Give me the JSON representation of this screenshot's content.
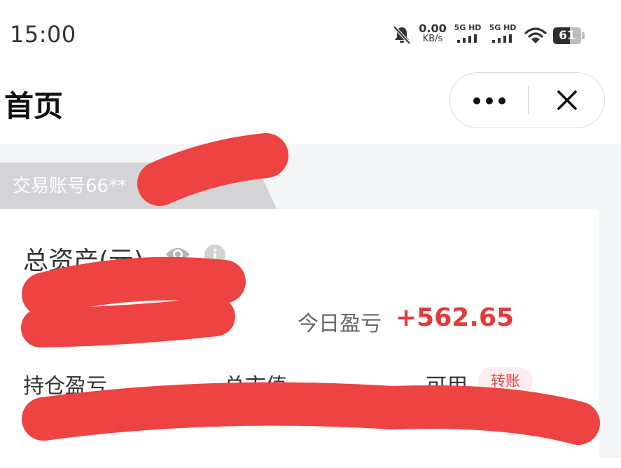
{
  "status_bar": {
    "time": "15:00",
    "net_speed_value": "0.00",
    "net_speed_unit": "KB/s",
    "sim1_label": "5G HD",
    "sim2_label": "5G HD",
    "battery_level": "61",
    "battery_fraction": 0.61,
    "icons": [
      "bell-muted-icon",
      "signal-icon",
      "wifi-icon",
      "battery-icon"
    ]
  },
  "nav": {
    "title": "首页",
    "more_icon": "more-dots-icon",
    "close_icon": "close-icon"
  },
  "account": {
    "label": "交易账号66**"
  },
  "assets": {
    "total_label": "总资产(元)",
    "eye_icon": "eye-icon",
    "info_icon": "info-icon",
    "today_pnl_label": "今日盈亏",
    "today_pnl_value": "+562.65"
  },
  "columns": {
    "position_pnl": "持仓盈亏",
    "market_value": "总市值",
    "available": "可用",
    "transfer_button": "转账"
  },
  "colors": {
    "accent_red": "#e23b3b",
    "redaction_red": "#ee4343",
    "background_gray": "#f4f5f7"
  }
}
